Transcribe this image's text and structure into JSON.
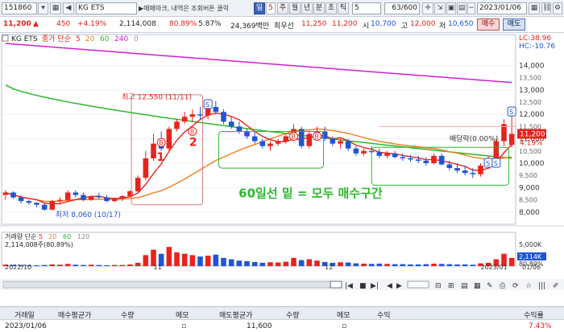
{
  "toolbar": {
    "code": "151860",
    "name": "KG ETS",
    "notice": "▶매매마크, 내역은 조회버튼 클릭",
    "period_buttons": [
      "일",
      "5",
      "주",
      "월",
      "년",
      "분",
      "초",
      "틱"
    ],
    "period_selected": "일",
    "count_value": "5",
    "page_counter": "63/600",
    "date": "2023/01/06"
  },
  "price": {
    "current": "11,200",
    "change": "450",
    "change_pct": "+4.19%",
    "volume": "2,114,008",
    "vol_ratio": "80.89%",
    "turnover": "5.87%",
    "amount": "24,369백만",
    "priority_label": "최우선",
    "priority": "11,250",
    "priority2": "11,200",
    "open_label": "시",
    "open": "10,700",
    "high_label": "고",
    "high": "12,000",
    "low_label": "저",
    "low": "10,650",
    "buy_label": "매수",
    "sell_label": "매도"
  },
  "chart": {
    "legend_name": "KG ETS",
    "legend_ma_label": "종가 단순",
    "ma_periods": [
      "5",
      "20",
      "60",
      "240",
      "0"
    ],
    "lc_label": "LC:38.96",
    "hc_label": "HC:-10.76",
    "max_label": "최고 12,550 (11/11)",
    "min_label": "최저 8,060 (10/17)",
    "dividend_label": "배당락(0.00%)",
    "annotation": "60일선 밑 = 모두 매수구간",
    "wave1": "1",
    "wave2": "2",
    "price_axis": [
      "14,000",
      "13,000",
      "12,000",
      "11,000",
      "10,000",
      "9,000",
      "8,000"
    ],
    "price_axis_extra": [
      "13,500",
      "12,500",
      "11,500",
      "10,500",
      "9,500",
      "8,500"
    ],
    "current_tag": "11,200",
    "current_pct": "4.19%",
    "volume_legend": "거래량 단순",
    "volume_ma": [
      "5",
      "20",
      "60",
      "120"
    ],
    "volume_value": "2,114,008주(80.89%)",
    "volume_axis": [
      "5,000K",
      "2,114K",
      "80.89%"
    ],
    "date_axis": [
      "2022/10",
      "11",
      "12",
      "2023/01",
      "01/06"
    ],
    "colors": {
      "up": "#e8231d",
      "down": "#1f55d6",
      "ma5": "#e8231d",
      "ma20": "#f07e1c",
      "ma60": "#2db82d",
      "ma240": "#d020d0"
    }
  },
  "chart_data": {
    "type": "candlestick",
    "y_range": [
      7500,
      15000
    ],
    "x": [
      "10/04",
      "10/05",
      "10/06",
      "10/07",
      "10/11",
      "10/12",
      "10/13",
      "10/14",
      "10/17",
      "10/18",
      "10/19",
      "10/20",
      "10/21",
      "10/24",
      "10/25",
      "10/26",
      "10/27",
      "10/28",
      "10/31",
      "11/01",
      "11/02",
      "11/03",
      "11/04",
      "11/07",
      "11/08",
      "11/09",
      "11/10",
      "11/11",
      "11/14",
      "11/15",
      "11/16",
      "11/17",
      "11/18",
      "11/21",
      "11/22",
      "11/23",
      "11/24",
      "11/25",
      "11/28",
      "11/29",
      "11/30",
      "12/01",
      "12/02",
      "12/05",
      "12/06",
      "12/07",
      "12/08",
      "12/09",
      "12/12",
      "12/13",
      "12/14",
      "12/15",
      "12/16",
      "12/19",
      "12/20",
      "12/21",
      "12/22",
      "12/23",
      "12/26",
      "12/27",
      "12/28",
      "01/02",
      "01/03",
      "01/04",
      "01/05",
      "01/06"
    ],
    "ohlc": [
      [
        8700,
        8900,
        8500,
        8800
      ],
      [
        8800,
        8850,
        8550,
        8600
      ],
      [
        8600,
        8700,
        8350,
        8450
      ],
      [
        8450,
        8500,
        8300,
        8380
      ],
      [
        8380,
        8400,
        8200,
        8300
      ],
      [
        8300,
        8350,
        8060,
        8100
      ],
      [
        8100,
        8500,
        8060,
        8450
      ],
      [
        8450,
        8600,
        8300,
        8500
      ],
      [
        8500,
        8900,
        8400,
        8800
      ],
      [
        8800,
        8900,
        8600,
        8700
      ],
      [
        8700,
        8800,
        8450,
        8500
      ],
      [
        8500,
        8700,
        8450,
        8650
      ],
      [
        8650,
        8800,
        8550,
        8600
      ],
      [
        8600,
        8700,
        8400,
        8450
      ],
      [
        8450,
        8600,
        8400,
        8550
      ],
      [
        8550,
        8700,
        8450,
        8650
      ],
      [
        8650,
        8900,
        8600,
        8850
      ],
      [
        8850,
        9500,
        8800,
        9400
      ],
      [
        9400,
        10500,
        9300,
        10200
      ],
      [
        10200,
        11200,
        10100,
        10800
      ],
      [
        10800,
        11300,
        10500,
        10600
      ],
      [
        10600,
        11500,
        10500,
        11400
      ],
      [
        11400,
        11800,
        11300,
        11700
      ],
      [
        11700,
        12100,
        11600,
        11900
      ],
      [
        11900,
        12200,
        11700,
        12000
      ],
      [
        12000,
        12300,
        11800,
        11950
      ],
      [
        11950,
        12400,
        11800,
        12300
      ],
      [
        12300,
        12550,
        12000,
        12100
      ],
      [
        12100,
        12200,
        11600,
        11700
      ],
      [
        11700,
        11900,
        11400,
        11500
      ],
      [
        11500,
        11700,
        11200,
        11300
      ],
      [
        11300,
        11400,
        11000,
        11100
      ],
      [
        11100,
        11300,
        10800,
        10900
      ],
      [
        10900,
        11000,
        10600,
        10700
      ],
      [
        10700,
        10900,
        10500,
        10800
      ],
      [
        10800,
        11000,
        10700,
        10900
      ],
      [
        10900,
        11200,
        10800,
        11100
      ],
      [
        11100,
        11600,
        11000,
        11400
      ],
      [
        11400,
        11500,
        10600,
        10700
      ],
      [
        10700,
        11300,
        10600,
        11200
      ],
      [
        11200,
        11500,
        11000,
        11300
      ],
      [
        11300,
        11500,
        10900,
        11000
      ],
      [
        11000,
        11100,
        10700,
        10800
      ],
      [
        10800,
        11000,
        10600,
        10900
      ],
      [
        10900,
        11000,
        10500,
        10600
      ],
      [
        10600,
        10700,
        10300,
        10400
      ],
      [
        10400,
        10600,
        10300,
        10500
      ],
      [
        10500,
        10700,
        10400,
        10450
      ],
      [
        10450,
        10600,
        10200,
        10300
      ],
      [
        10300,
        10500,
        10200,
        10400
      ],
      [
        10400,
        10500,
        10200,
        10250
      ],
      [
        10250,
        10400,
        10100,
        10200
      ],
      [
        10200,
        10350,
        10050,
        10150
      ],
      [
        10150,
        10300,
        10000,
        10100
      ],
      [
        10100,
        10250,
        9900,
        10000
      ],
      [
        10000,
        10400,
        9950,
        10300
      ],
      [
        10300,
        10400,
        9900,
        9950
      ],
      [
        9950,
        10100,
        9700,
        9800
      ],
      [
        9800,
        10000,
        9600,
        9700
      ],
      [
        9700,
        9900,
        9500,
        9600
      ],
      [
        9600,
        9800,
        9400,
        9550
      ],
      [
        9550,
        10000,
        9450,
        9900
      ],
      [
        9900,
        10300,
        9800,
        10200
      ],
      [
        10200,
        11000,
        10100,
        10900
      ],
      [
        10900,
        11800,
        10700,
        11600
      ],
      [
        10750,
        12000,
        10650,
        11200
      ]
    ],
    "volume_pct": [
      5,
      4,
      4,
      3,
      3,
      4,
      6,
      5,
      8,
      5,
      4,
      5,
      4,
      3,
      4,
      4,
      6,
      12,
      40,
      60,
      45,
      70,
      50,
      45,
      40,
      35,
      38,
      42,
      30,
      25,
      20,
      18,
      15,
      12,
      14,
      13,
      16,
      30,
      22,
      25,
      20,
      15,
      12,
      14,
      13,
      10,
      9,
      8,
      9,
      8,
      7,
      7,
      6,
      6,
      7,
      9,
      8,
      7,
      6,
      6,
      5,
      10,
      12,
      25,
      45,
      30
    ]
  },
  "grid": {
    "headers": [
      "거래일",
      "매수평균가",
      "수량",
      "메모",
      "매도평균가",
      "수량",
      "메모",
      "수익",
      "수익률"
    ],
    "row": [
      "2023/01/06",
      "",
      "",
      "",
      "11,600",
      "",
      "",
      "",
      "7.43%"
    ]
  }
}
